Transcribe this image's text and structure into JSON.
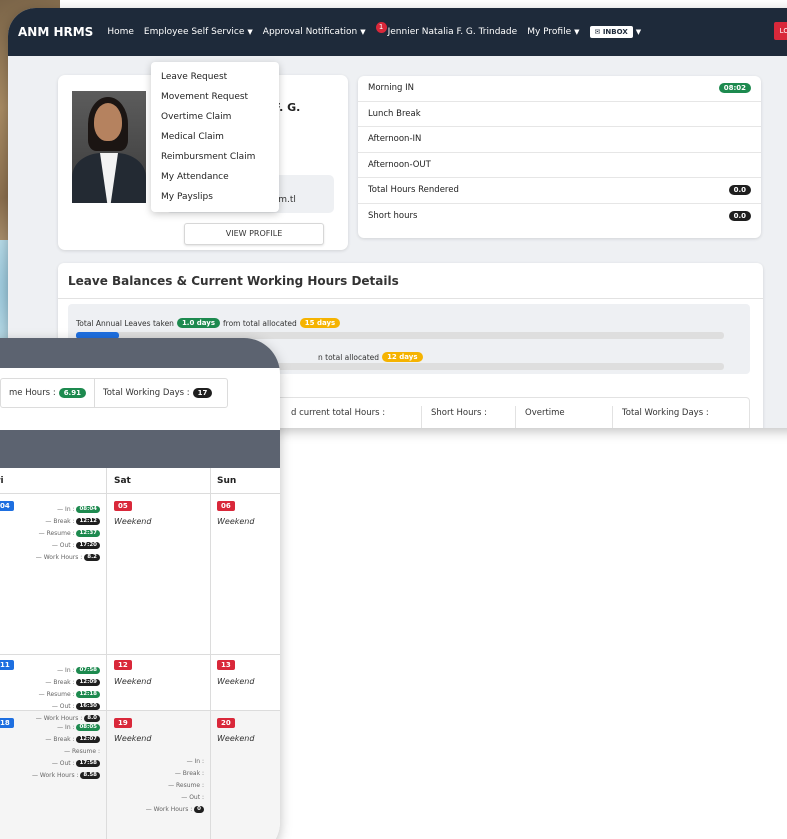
{
  "navbar": {
    "brand": "ANM HRMS",
    "home": "Home",
    "ess": "Employee Self Service",
    "approval": "Approval Notification",
    "notif_count": "1",
    "user": "Jennier Natalia F. G. Trindade",
    "my_profile": "My Profile",
    "inbox": "INBOX",
    "logout": "LOG O"
  },
  "dropdown": {
    "items": [
      "Leave Request",
      "Movement Request",
      "Overtime Claim",
      "Medical Claim",
      "Reimbursment Claim",
      "My Attendance",
      "My Payslips"
    ]
  },
  "profile": {
    "name_partial": "a F. G.",
    "email_partial": "@anm.tl",
    "view_profile": "VIEW PROFILE"
  },
  "attendance": {
    "rows": [
      {
        "label": "Morning IN",
        "value": "08:02"
      },
      {
        "label": "Lunch Break",
        "value": ""
      },
      {
        "label": "Afternoon-IN",
        "value": ""
      },
      {
        "label": "Afternoon-OUT",
        "value": ""
      },
      {
        "label": "Total Hours Rendered",
        "value": "0.0"
      },
      {
        "label": "Short hours",
        "value": "0.0"
      }
    ]
  },
  "leave": {
    "title": "Leave Balances & Current Working Hours Details",
    "annual_prefix": "Total Annual Leaves taken",
    "annual_taken": "1.0 days",
    "annual_mid": "from total allocated",
    "annual_allocated": "15 days",
    "annual_progress": 0.067,
    "sick_mid": "n total allocated",
    "sick_allocated": "12 days",
    "summary": {
      "hours_label": "d current total Hours :",
      "short_label": "Short Hours :",
      "overtime_label": "Overtime",
      "days_label": "Total Working Days :"
    }
  },
  "stats": {
    "hours_label": "me Hours :",
    "hours_value": "6.91",
    "days_label": "Total Working Days :",
    "days_value": "17"
  },
  "calendar": {
    "days": [
      "ri",
      "Sat",
      "Sun"
    ],
    "weekend_label": "Weekend",
    "week1": {
      "fri": "04",
      "sat": "05",
      "sun": "06",
      "in": "08:04",
      "break": "12:12",
      "resume": "12:37",
      "out": "17:20",
      "hours": "8.2"
    },
    "week2": {
      "fri": "11",
      "sat": "12",
      "sun": "13",
      "in": "07:58",
      "break": "12:09",
      "resume": "12:18",
      "out": "16:30",
      "hours": "8.0"
    },
    "week3": {
      "fri": "18",
      "sat": "19",
      "sun": "20",
      "in": "08:05",
      "break": "12:07",
      "out": "17:58",
      "hours": "8.58",
      "sat_hours": "0"
    },
    "labels": {
      "in": "In :",
      "break": "Break :",
      "resume": "Resume :",
      "out": "Out :",
      "hours": "Work Hours :"
    }
  },
  "colors": {
    "navbar": "#1e2a3a",
    "green": "#1d8a4f",
    "red": "#d9283a",
    "blue": "#1e6fe0",
    "yellow": "#f5b301"
  }
}
